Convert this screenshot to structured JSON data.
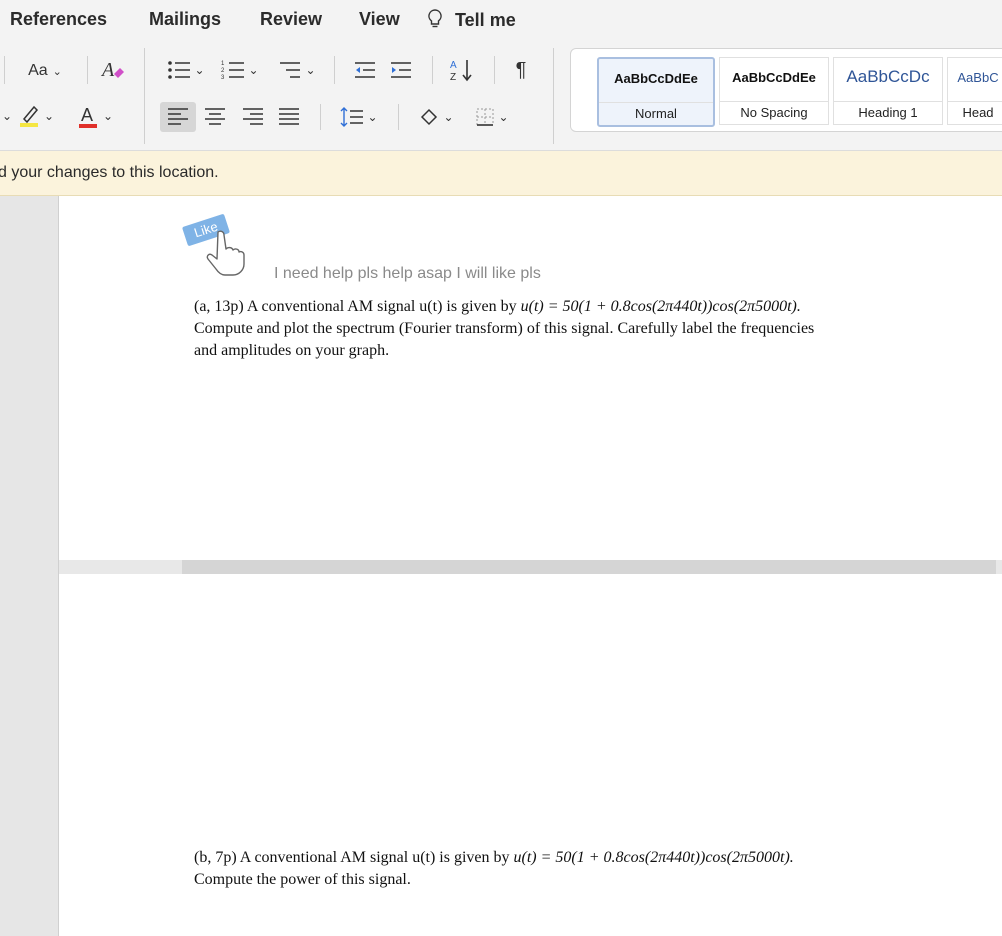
{
  "menu": {
    "tabs": [
      "References",
      "Mailings",
      "Review",
      "View",
      "Tell me"
    ]
  },
  "ribbon": {
    "font_size_button": "Aa",
    "styles": [
      {
        "sample": "AaBbCcDdEe",
        "label": "Normal"
      },
      {
        "sample": "AaBbCcDdEe",
        "label": "No Spacing"
      },
      {
        "sample": "AaBbCcDc",
        "label": "Heading 1"
      },
      {
        "sample": "AaBbC",
        "label": "Head"
      }
    ],
    "colors": {
      "highlight": "#f5e642",
      "font_color": "#e0302a",
      "heading_blue": "#2f5597"
    }
  },
  "infobar": {
    "text": "d your changes to this location."
  },
  "document": {
    "like_badge": "Like",
    "help_text": "I need help pls help asap I will like pls",
    "question_a": {
      "prefix": "(a, 13p) A conventional AM signal u(t) is given by ",
      "formula": "u(t) = 50(1 + 0.8cos(2π440t))cos(2π5000t).",
      "line2": "Compute and plot the spectrum (Fourier transform) of this signal. Carefully label the frequencies",
      "line3": "and amplitudes on your graph."
    },
    "question_b": {
      "prefix": "(b, 7p) A conventional AM signal u(t) is given by ",
      "formula": "u(t) = 50(1 + 0.8cos(2π440t))cos(2π5000t).",
      "line2": "Compute the power of this signal."
    }
  }
}
